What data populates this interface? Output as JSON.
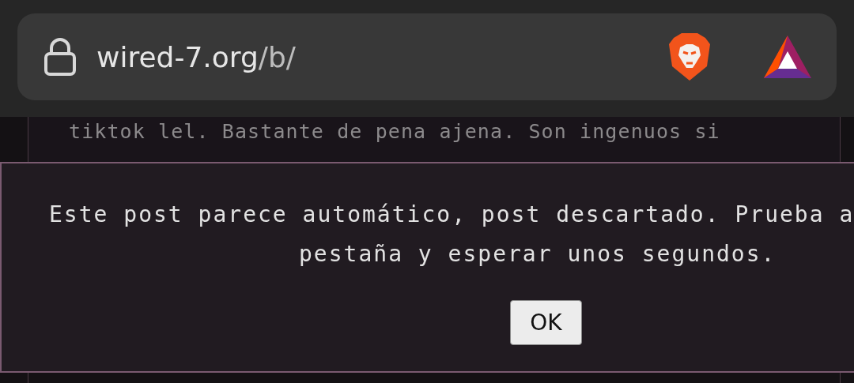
{
  "address_bar": {
    "domain": "wired-7.org",
    "path": "/b/"
  },
  "post": {
    "text": "tiktok lel. Bastante de pena ajena. Son ingenuos si"
  },
  "dialog": {
    "lines": [
      "Este post parece automático, post descartado. Prueba a",
      "pestaña y esperar unos segundos."
    ],
    "button": "OK"
  }
}
